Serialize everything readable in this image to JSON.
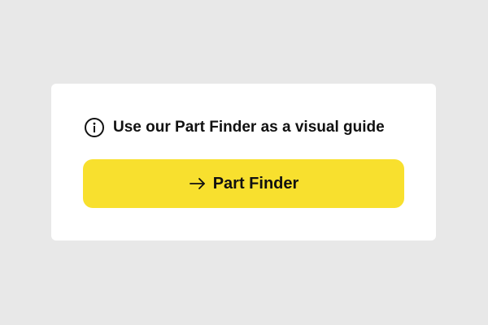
{
  "card": {
    "info_icon": "info-circle-icon",
    "message": "Use our Part Finder as a visual guide",
    "button": {
      "icon": "arrow-right-icon",
      "label": "Part Finder"
    }
  },
  "colors": {
    "background": "#e8e8e8",
    "card": "#ffffff",
    "accent": "#f8e02e",
    "text": "#111111"
  }
}
